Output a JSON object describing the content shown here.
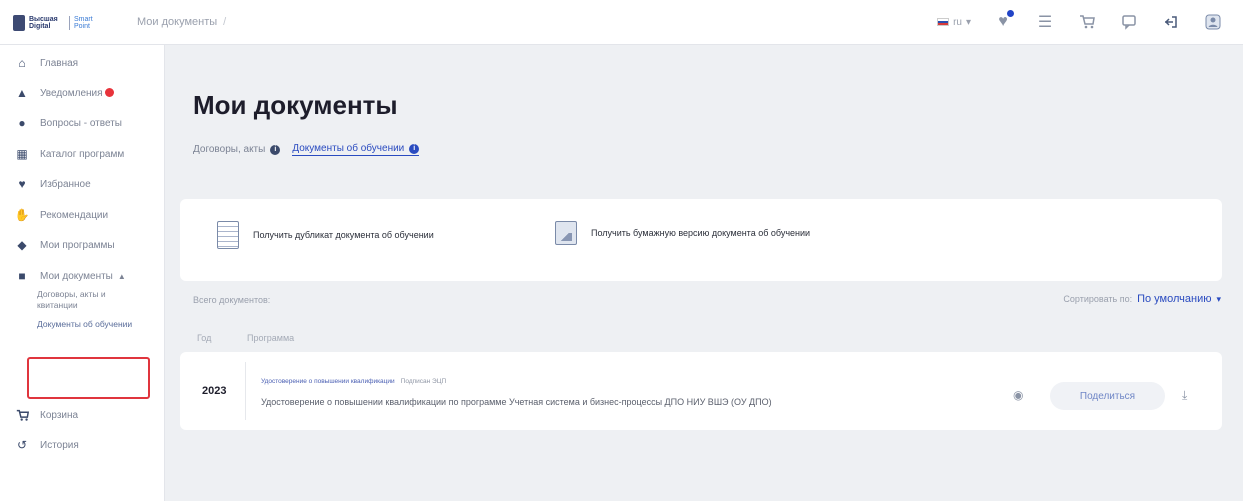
{
  "header": {
    "logo_text_1": "Высшая Digital",
    "logo_text_2": "Smart Point",
    "breadcrumb": "Мои документы",
    "breadcrumb_sep": "/",
    "lang": "ru",
    "accent": "#2a4bc0"
  },
  "sidebar": {
    "items": [
      {
        "label": "Главная",
        "icon": "home-icon"
      },
      {
        "label": "Уведомления",
        "icon": "bell-icon"
      },
      {
        "label": "Вопросы - ответы",
        "icon": "help-icon"
      },
      {
        "label": "Каталог программ",
        "icon": "catalog-icon"
      },
      {
        "label": "Избранное",
        "icon": "heart-icon"
      },
      {
        "label": "Рекомендации",
        "icon": "thumbs-up-icon"
      },
      {
        "label": "Мои программы",
        "icon": "graduation-cap-icon"
      },
      {
        "label": "Мои документы",
        "icon": "folder-icon"
      },
      {
        "label": "Корзина",
        "icon": "cart-icon"
      },
      {
        "label": "История",
        "icon": "history-icon"
      }
    ],
    "sub_items": [
      {
        "label": "Договоры, акты и квитанции"
      },
      {
        "label": "Документы об обучении"
      }
    ]
  },
  "main": {
    "title": "Мои документы",
    "tabs": [
      {
        "label": "Договоры, акты"
      },
      {
        "label": "Документы об обучении"
      }
    ],
    "actions": [
      {
        "label": "Получить дубликат документа об обучении"
      },
      {
        "label": "Получить бумажную версию документа об обучении"
      }
    ],
    "total_label": "Всего документов:",
    "sort_label": "Сортировать по:",
    "sort_value": "По умолчанию",
    "columns": [
      "Год",
      "Программа"
    ],
    "rows": [
      {
        "year": "2023",
        "doc_type": "Удостоверение о повышении квалификации",
        "doc_tag": "Подписан ЭЦП",
        "title": "Удостоверение о повышении квалификации по программе Учетная система и бизнес-процессы ДПО НИУ ВШЭ (ОУ ДПО)",
        "share_label": "Поделиться"
      }
    ]
  }
}
